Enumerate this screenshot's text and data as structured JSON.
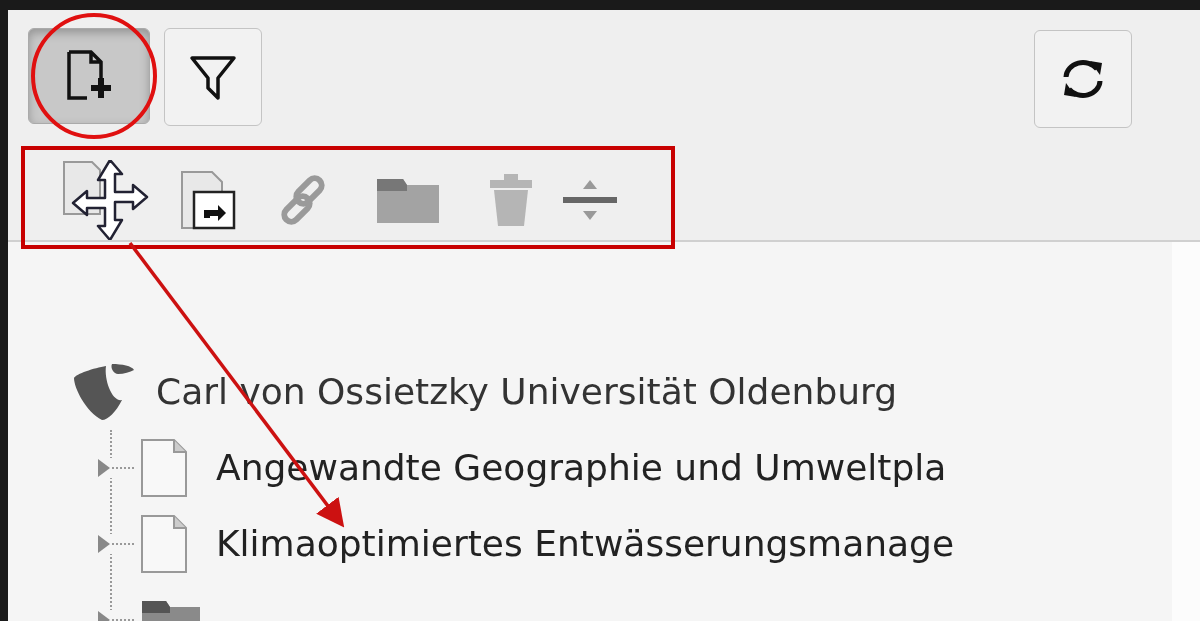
{
  "toolbar": {
    "buttons": [
      {
        "kind": "new-page",
        "pressed": true
      },
      {
        "kind": "filter",
        "pressed": false
      }
    ],
    "refresh": {
      "kind": "refresh"
    }
  },
  "drag_items": [
    {
      "kind": "page-move"
    },
    {
      "kind": "shortcut"
    },
    {
      "kind": "link"
    },
    {
      "kind": "folder"
    },
    {
      "kind": "trash"
    },
    {
      "kind": "divider"
    }
  ],
  "tree": {
    "root": {
      "label": "Carl von Ossietzky Universität Oldenburg",
      "children": [
        {
          "kind": "page",
          "label": "Angewandte Geographie und Umweltpla",
          "expanded": false
        },
        {
          "kind": "page",
          "label": "Klimaoptimiertes Entwässerungsmanage",
          "expanded": false
        },
        {
          "kind": "folder",
          "expanded": false
        }
      ]
    }
  }
}
